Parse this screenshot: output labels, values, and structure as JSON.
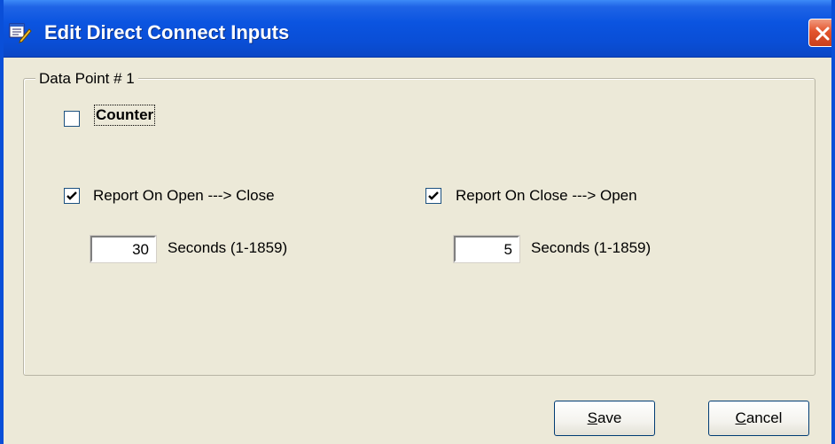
{
  "window": {
    "title": "Edit Direct Connect Inputs"
  },
  "group": {
    "label": "Data Point # 1"
  },
  "counter": {
    "label": "Counter",
    "checked": false
  },
  "open_to_close": {
    "label": "Report On Open ---> Close",
    "checked": true,
    "seconds_value": "30",
    "seconds_label": "Seconds (1-1859)"
  },
  "close_to_open": {
    "label": "Report On Close ---> Open",
    "checked": true,
    "seconds_value": "5",
    "seconds_label": "Seconds (1-1859)"
  },
  "buttons": {
    "save_mnemonic": "S",
    "save_rest": "ave",
    "cancel_mnemonic": "C",
    "cancel_rest": "ancel"
  },
  "icons": {
    "app": "edit-form-icon",
    "close": "close-icon",
    "check": "checkmark-icon"
  },
  "colors": {
    "titlebar": "#0a4ed6",
    "close_button": "#e3542c",
    "dialog_background": "#ece9d8"
  }
}
